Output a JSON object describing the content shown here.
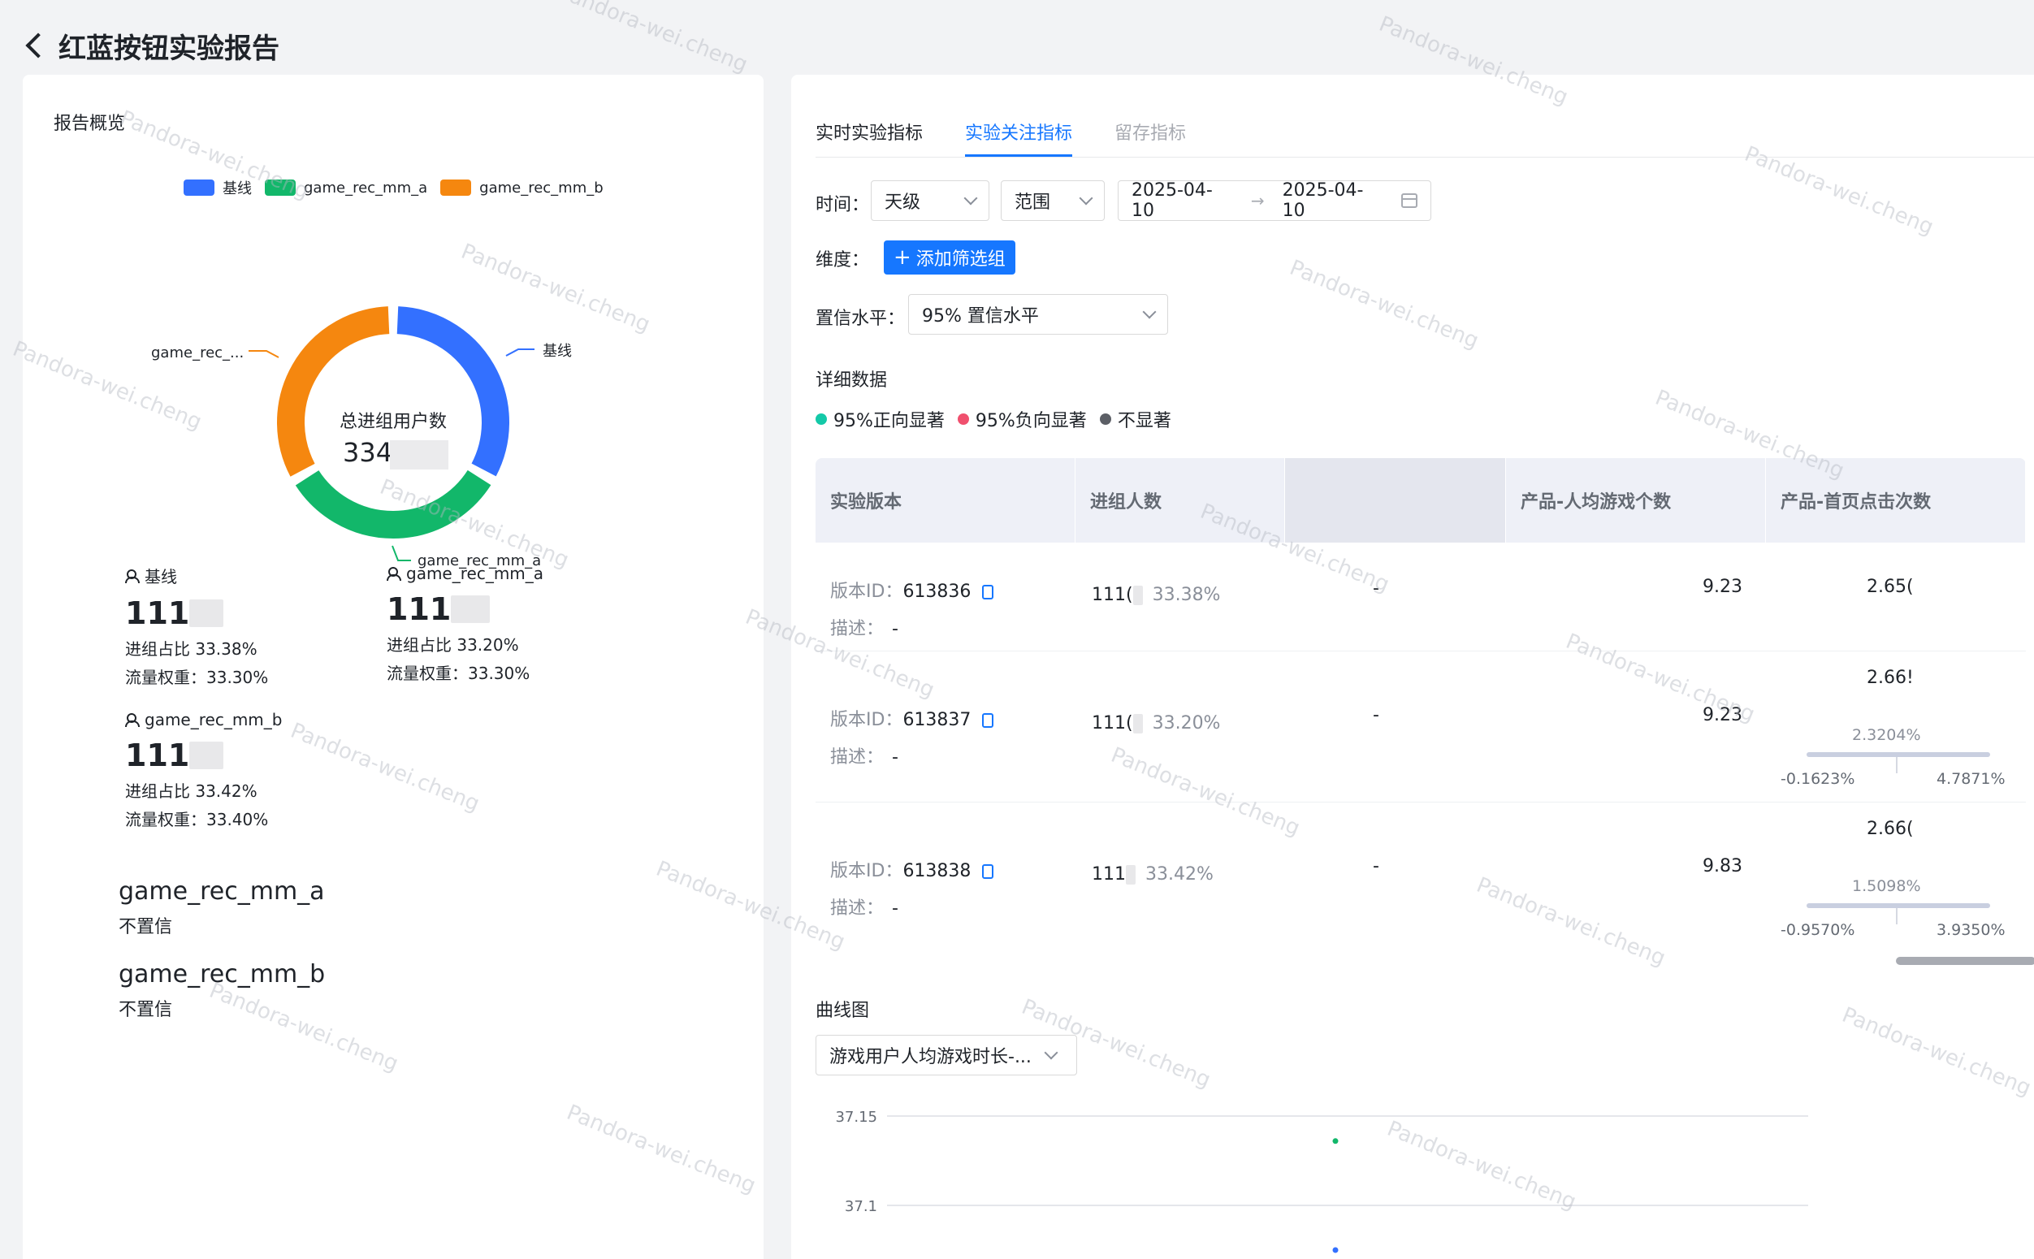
{
  "header": {
    "title": "红蓝按钮实验报告"
  },
  "overview": {
    "section_title": "报告概览",
    "legend": [
      {
        "name": "基线",
        "color": "#3370ff"
      },
      {
        "name": "game_rec_mm_a",
        "color": "#12b76a"
      },
      {
        "name": "game_rec_mm_b",
        "color": "#f5870f"
      }
    ],
    "donut": {
      "center_label": "总进组用户数",
      "center_value": "334",
      "label_left": "game_rec_...",
      "label_right": "基线",
      "label_bottom": "game_rec_mm_a",
      "shares": [
        33.38,
        33.2,
        33.42
      ]
    },
    "groups": [
      {
        "name": "基线",
        "count": "111",
        "ratio": "进组占比 33.38%",
        "weight": "流量权重：33.30%"
      },
      {
        "name": "game_rec_mm_a",
        "count": "111",
        "ratio": "进组占比 33.20%",
        "weight": "流量权重：33.30%"
      },
      {
        "name": "game_rec_mm_b",
        "count": "111",
        "ratio": "进组占比 33.42%",
        "weight": "流量权重：33.40%"
      }
    ],
    "confidence": [
      {
        "name": "game_rec_mm_a",
        "status": "不置信"
      },
      {
        "name": "game_rec_mm_b",
        "status": "不置信"
      }
    ]
  },
  "tabs": [
    {
      "label": "实时实验指标",
      "state": "normal"
    },
    {
      "label": "实验关注指标",
      "state": "active"
    },
    {
      "label": "留存指标",
      "state": "muted"
    }
  ],
  "filters": {
    "time_label": "时间：",
    "granularity": "天级",
    "range_type": "范围",
    "date_start": "2025-04-10",
    "date_end": "2025-04-10",
    "dimension_label": "维度：",
    "add_filter": "添加筛选组",
    "confidence_label": "置信水平：",
    "confidence_value": "95% 置信水平"
  },
  "details": {
    "title": "详细数据",
    "sig_legend": [
      {
        "label": "95%正向显著",
        "color": "#14c9a8"
      },
      {
        "label": "95%负向显著",
        "color": "#f0506e"
      },
      {
        "label": "不显著",
        "color": "#5c5f66"
      }
    ],
    "columns": [
      "实验版本",
      "进组人数",
      "",
      "产品-人均游戏个数",
      "产品-首页点击次数"
    ],
    "version_prefix": "版本ID：",
    "desc_prefix": "描述：",
    "rows": [
      {
        "version_id": "613836",
        "desc": "-",
        "users": "111(",
        "share": "33.38%",
        "blank": "-",
        "games": "9.23",
        "clicks": "2.65("
      },
      {
        "version_id": "613837",
        "desc": "-",
        "users": "111(",
        "share": "33.20%",
        "blank": "-",
        "games": "9.23",
        "clicks": "2.66!",
        "ci_center": "2.3204%",
        "ci_low": "-0.1623%",
        "ci_high": "4.7871%"
      },
      {
        "version_id": "613838",
        "desc": "-",
        "users": "111",
        "share": "33.42%",
        "blank": "-",
        "games": "9.83",
        "clicks": "2.66(",
        "ci_center": "1.5098%",
        "ci_low": "-0.9570%",
        "ci_high": "3.9350%"
      }
    ]
  },
  "curve": {
    "title": "曲线图",
    "metric_select": "游戏用户人均游戏时长-...",
    "y_ticks": [
      "37.15",
      "37.1"
    ],
    "points": [
      {
        "series": "game_rec_mm_a",
        "y": 37.136,
        "color": "#12b76a"
      },
      {
        "series": "基线",
        "y": 37.075,
        "color": "#3370ff"
      }
    ]
  },
  "watermark": "Pandora-wei.cheng"
}
